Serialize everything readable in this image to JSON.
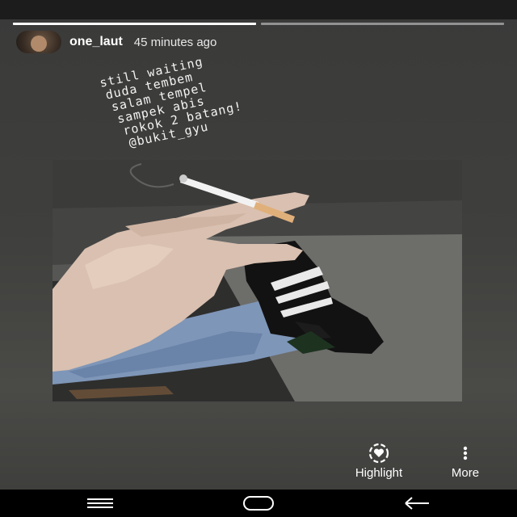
{
  "story": {
    "progress": [
      1.0,
      0.0
    ],
    "username": "one_laut",
    "timestamp": "45 minutes ago"
  },
  "caption": {
    "lines": [
      "still waiting",
      "duda tembem",
      "salam tempel",
      "sampek abis",
      "rokok 2 batang!",
      "@bukit_gyu"
    ]
  },
  "actions": {
    "highlight_label": "Highlight",
    "more_label": "More"
  },
  "icons": {
    "highlight": "heart-circle-icon",
    "more": "vertical-dots-icon",
    "nav_menu": "menu-lines-icon",
    "nav_home": "home-oval-icon",
    "nav_back": "back-arrow-icon"
  },
  "colors": {
    "background": "#3f3f3d",
    "text": "#ffffff"
  }
}
